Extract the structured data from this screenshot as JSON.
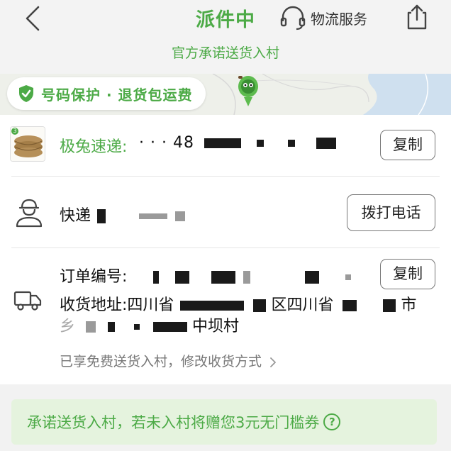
{
  "header": {
    "title": "派件中",
    "service_label": "物流服务",
    "subtitle": "官方承诺送货入村"
  },
  "map": {
    "protect_label": "号码保护 · 退货包运费"
  },
  "shipment": {
    "carrier": "极兔速递:",
    "tracking_visible": "· · · 48",
    "copy_label": "复制"
  },
  "courier": {
    "label": "快递",
    "call_label": "拨打电话"
  },
  "order": {
    "label": "订单编号:",
    "copy_label": "复制"
  },
  "address": {
    "label": "收货地址:",
    "province": "四川省",
    "district_suffix": "区四川省",
    "city_suffix": "市",
    "line2_prefix": "乡",
    "village": "中坝村",
    "free_note": "已享免费送货入村，修改收货方式"
  },
  "promise": {
    "text": "承诺送货入村，若未入村将赠您3元无门槛券",
    "help_symbol": "?"
  },
  "colors": {
    "accent": "#4caa46",
    "promise_bg": "#e5f3de",
    "page_bg": "#f2f2f2"
  },
  "icons": [
    "back-icon",
    "headset-icon",
    "share-icon",
    "shield-check-icon",
    "courier-pin-icon",
    "courier-avatar-icon",
    "truck-icon",
    "chevron-right-icon",
    "help-circle-icon"
  ]
}
